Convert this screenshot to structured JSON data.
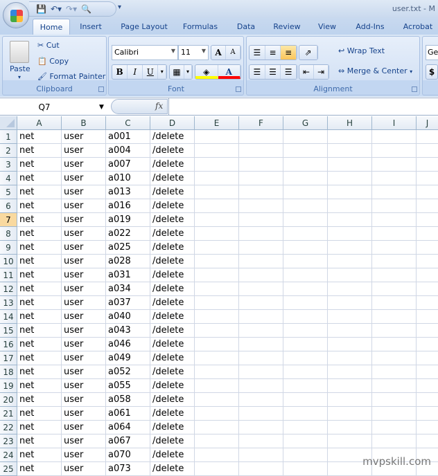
{
  "window": {
    "title": "user.txt - M"
  },
  "qat": {
    "save_icon": "save-icon",
    "undo_icon": "undo-icon",
    "redo_icon": "redo-icon",
    "preview_icon": "print-preview-icon"
  },
  "tabs": [
    "Home",
    "Insert",
    "Page Layout",
    "Formulas",
    "Data",
    "Review",
    "View",
    "Add-Ins",
    "Acrobat"
  ],
  "ribbon": {
    "clipboard": {
      "label": "Clipboard",
      "paste": "Paste",
      "cut": "Cut",
      "copy": "Copy",
      "format_painter": "Format Painter"
    },
    "font": {
      "label": "Font",
      "font_name": "Calibri",
      "font_size": "11",
      "bold": "B",
      "italic": "I",
      "underline": "U",
      "grow": "A",
      "shrink": "A",
      "font_color": "A",
      "fill_color_hex": "#ffff00",
      "font_color_hex": "#ff0000"
    },
    "alignment": {
      "label": "Alignment",
      "wrap_text": "Wrap Text",
      "merge_center": "Merge & Center"
    },
    "number": {
      "format": "Ge",
      "currency": "$"
    }
  },
  "formula_bar": {
    "name_box": "Q7",
    "fx": "fx",
    "value": ""
  },
  "sheet": {
    "columns": [
      "A",
      "B",
      "C",
      "D",
      "E",
      "F",
      "G",
      "H",
      "I",
      "J"
    ],
    "selected_row": 7,
    "rows": [
      [
        "1",
        "net",
        "user",
        "a001",
        "/delete"
      ],
      [
        "2",
        "net",
        "user",
        "a004",
        "/delete"
      ],
      [
        "3",
        "net",
        "user",
        "a007",
        "/delete"
      ],
      [
        "4",
        "net",
        "user",
        "a010",
        "/delete"
      ],
      [
        "5",
        "net",
        "user",
        "a013",
        "/delete"
      ],
      [
        "6",
        "net",
        "user",
        "a016",
        "/delete"
      ],
      [
        "7",
        "net",
        "user",
        "a019",
        "/delete"
      ],
      [
        "8",
        "net",
        "user",
        "a022",
        "/delete"
      ],
      [
        "9",
        "net",
        "user",
        "a025",
        "/delete"
      ],
      [
        "10",
        "net",
        "user",
        "a028",
        "/delete"
      ],
      [
        "11",
        "net",
        "user",
        "a031",
        "/delete"
      ],
      [
        "12",
        "net",
        "user",
        "a034",
        "/delete"
      ],
      [
        "13",
        "net",
        "user",
        "a037",
        "/delete"
      ],
      [
        "14",
        "net",
        "user",
        "a040",
        "/delete"
      ],
      [
        "15",
        "net",
        "user",
        "a043",
        "/delete"
      ],
      [
        "16",
        "net",
        "user",
        "a046",
        "/delete"
      ],
      [
        "17",
        "net",
        "user",
        "a049",
        "/delete"
      ],
      [
        "18",
        "net",
        "user",
        "a052",
        "/delete"
      ],
      [
        "19",
        "net",
        "user",
        "a055",
        "/delete"
      ],
      [
        "20",
        "net",
        "user",
        "a058",
        "/delete"
      ],
      [
        "21",
        "net",
        "user",
        "a061",
        "/delete"
      ],
      [
        "22",
        "net",
        "user",
        "a064",
        "/delete"
      ],
      [
        "23",
        "net",
        "user",
        "a067",
        "/delete"
      ],
      [
        "24",
        "net",
        "user",
        "a070",
        "/delete"
      ],
      [
        "25",
        "net",
        "user",
        "a073",
        "/delete"
      ]
    ]
  },
  "watermark": "mvpskill.com"
}
